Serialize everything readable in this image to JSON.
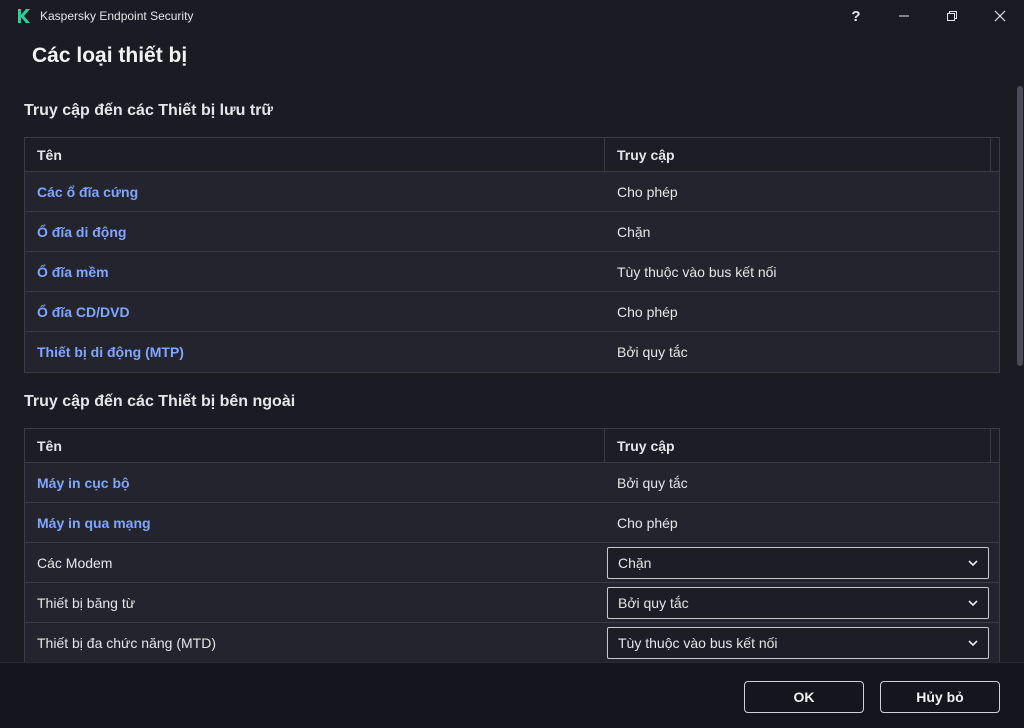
{
  "window": {
    "app_title": "Kaspersky Endpoint Security",
    "help_label": "?",
    "brand_color": "#2ad19b"
  },
  "page": {
    "title": "Các loại thiết bị"
  },
  "storage_section": {
    "title": "Truy cập đến các Thiết bị lưu trữ",
    "col_name": "Tên",
    "col_access": "Truy cập",
    "rows": [
      {
        "name": "Các ổ đĩa cứng",
        "access": "Cho phép"
      },
      {
        "name": "Ổ đĩa di động",
        "access": "Chặn"
      },
      {
        "name": "Ổ đĩa mềm",
        "access": "Tùy thuộc vào bus kết nối"
      },
      {
        "name": "Ổ đĩa CD/DVD",
        "access": "Cho phép"
      },
      {
        "name": "Thiết bị di động (MTP)",
        "access": "Bởi quy tắc"
      }
    ]
  },
  "external_section": {
    "title": "Truy cập đến các Thiết bị bên ngoài",
    "col_name": "Tên",
    "col_access": "Truy cập",
    "rows": [
      {
        "name": "Máy in cục bộ",
        "access": "Bởi quy tắc"
      },
      {
        "name": "Máy in qua mạng",
        "access": "Cho phép"
      },
      {
        "name": "Các Modem",
        "access": "Chặn"
      },
      {
        "name": "Thiết bị băng từ",
        "access": "Bởi quy tắc"
      },
      {
        "name": "Thiết bị đa chức năng (MTD)",
        "access": "Tùy thuộc vào bus kết nối"
      }
    ]
  },
  "footer": {
    "ok_label": "OK",
    "cancel_label": "Hủy bỏ"
  }
}
